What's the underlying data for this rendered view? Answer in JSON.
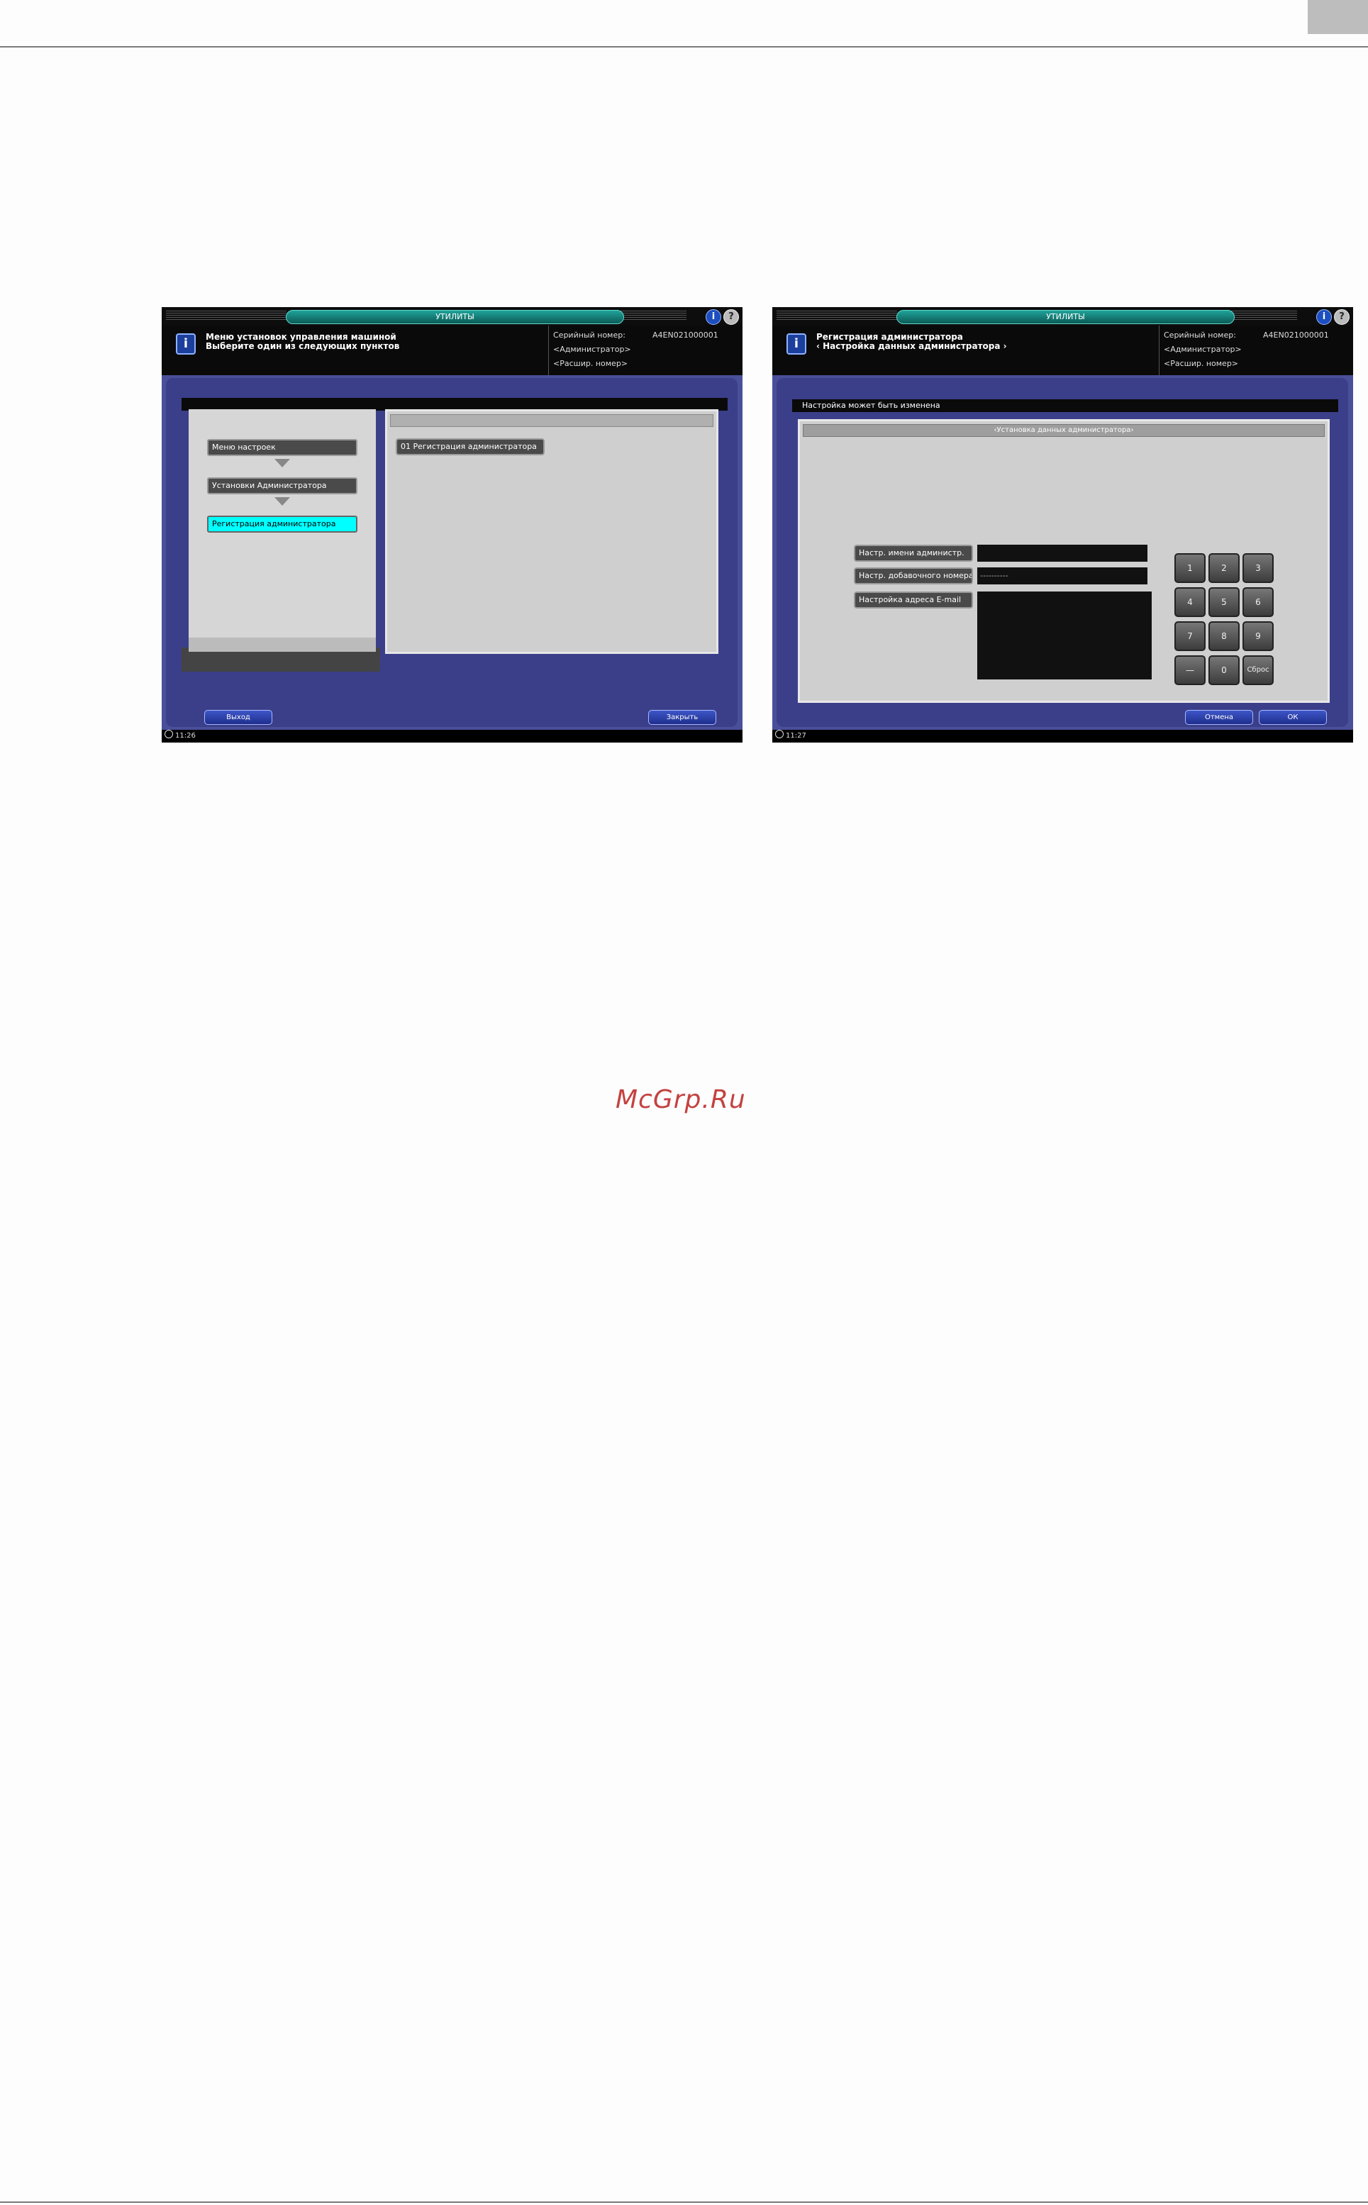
{
  "watermark": "McGrp.Ru",
  "screen1": {
    "title": "УТИЛИТЫ",
    "message_line1": "Меню установок управления машиной",
    "message_line2": "Выберите один из следующих пунктов",
    "serial_label": "Серийный номер:",
    "serial_value": "A4EN021000001",
    "role": "<Администратор>",
    "extended_number": "<Расшир. номер>",
    "nav": [
      {
        "label": "Меню настроек"
      },
      {
        "label": "Установки Администратора"
      },
      {
        "label": "Регистрация администратора"
      }
    ],
    "menu_item": "01 Регистрация администратора",
    "exit_button": "Выход",
    "close_button": "Закрыть",
    "time": "11:26"
  },
  "screen2": {
    "title": "УТИЛИТЫ",
    "message_line1": "Регистрация администратора",
    "message_line2": "‹ Настройка данных администратора ›",
    "serial_label": "Серийный номер:",
    "serial_value": "A4EN021000001",
    "role": "<Администратор>",
    "extended_number": "<Расшир. номер>",
    "band_text": "Настройка может быть изменена",
    "panel_header": "‹Установка данных администратора›",
    "fields": [
      {
        "label": "Настр. имени администр.",
        "value": ""
      },
      {
        "label": "Настр. добавочного номера",
        "value": "----------"
      },
      {
        "label": "Настройка адреса E-mail",
        "value": ""
      }
    ],
    "keypad": [
      "1",
      "2",
      "3",
      "4",
      "5",
      "6",
      "7",
      "8",
      "9",
      "—",
      "0",
      "Сброс"
    ],
    "cancel_button": "Отмена",
    "ok_button": "ОК",
    "time": "11:27"
  },
  "colors": {
    "frame_blue": "#4a4f9a",
    "title_pill": "#1fa39a",
    "active_nav": "#00ffff",
    "button_blue": "#2a3ca8",
    "watermark_red": "#c44240"
  }
}
